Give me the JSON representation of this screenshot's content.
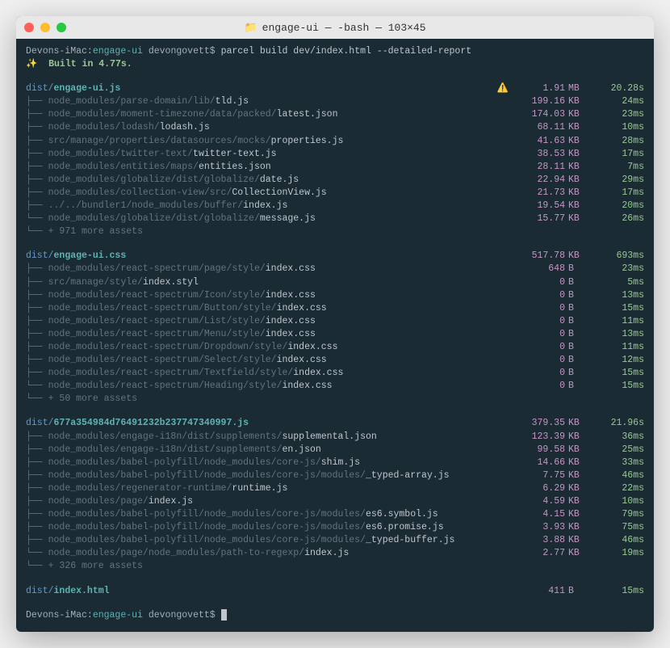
{
  "window": {
    "title_folder": "engage-ui",
    "title_sep": " — -bash — ",
    "title_dims": "103×45"
  },
  "prompt": {
    "host": "Devons-iMac:",
    "path": "engage-ui",
    "user": " devongovett$ ",
    "command": "parcel build dev/index.html --detailed-report"
  },
  "built": {
    "sparkle": "✨",
    "text": "  Built in 4.77s."
  },
  "bundles": [
    {
      "prefix": "dist/",
      "name": "engage-ui.js",
      "warn": "⚠️",
      "size": "1.91",
      "unit": "MB",
      "time": "20.28s",
      "assets": [
        {
          "dim": "node_modules/parse-domain/lib/",
          "file": "tld.js",
          "size": "199.16",
          "unit": "KB",
          "time": "24ms"
        },
        {
          "dim": "node_modules/moment-timezone/data/packed/",
          "file": "latest.json",
          "size": "174.03",
          "unit": "KB",
          "time": "23ms"
        },
        {
          "dim": "node_modules/lodash/",
          "file": "lodash.js",
          "size": "68.11",
          "unit": "KB",
          "time": "10ms"
        },
        {
          "dim": "src/manage/properties/datasources/mocks/",
          "file": "properties.js",
          "size": "41.63",
          "unit": "KB",
          "time": "28ms"
        },
        {
          "dim": "node_modules/twitter-text/",
          "file": "twitter-text.js",
          "size": "38.53",
          "unit": "KB",
          "time": "17ms"
        },
        {
          "dim": "node_modules/entities/maps/",
          "file": "entities.json",
          "size": "28.11",
          "unit": "KB",
          "time": "7ms"
        },
        {
          "dim": "node_modules/globalize/dist/globalize/",
          "file": "date.js",
          "size": "22.94",
          "unit": "KB",
          "time": "29ms"
        },
        {
          "dim": "node_modules/collection-view/src/",
          "file": "CollectionView.js",
          "size": "21.73",
          "unit": "KB",
          "time": "17ms"
        },
        {
          "dim": "../../bundler1/node_modules/buffer/",
          "file": "index.js",
          "size": "19.54",
          "unit": "KB",
          "time": "20ms"
        },
        {
          "dim": "node_modules/globalize/dist/globalize/",
          "file": "message.js",
          "size": "15.77",
          "unit": "KB",
          "time": "26ms"
        }
      ],
      "more": "+ 971 more assets"
    },
    {
      "prefix": "dist/",
      "name": "engage-ui.css",
      "warn": "",
      "size": "517.78",
      "unit": "KB",
      "time": "693ms",
      "assets": [
        {
          "dim": "node_modules/react-spectrum/page/style/",
          "file": "index.css",
          "size": "648",
          "unit": "B",
          "time": "23ms"
        },
        {
          "dim": "src/manage/style/",
          "file": "index.styl",
          "size": "0",
          "unit": "B",
          "time": "5ms"
        },
        {
          "dim": "node_modules/react-spectrum/Icon/style/",
          "file": "index.css",
          "size": "0",
          "unit": "B",
          "time": "13ms"
        },
        {
          "dim": "node_modules/react-spectrum/Button/style/",
          "file": "index.css",
          "size": "0",
          "unit": "B",
          "time": "15ms"
        },
        {
          "dim": "node_modules/react-spectrum/List/style/",
          "file": "index.css",
          "size": "0",
          "unit": "B",
          "time": "11ms"
        },
        {
          "dim": "node_modules/react-spectrum/Menu/style/",
          "file": "index.css",
          "size": "0",
          "unit": "B",
          "time": "13ms"
        },
        {
          "dim": "node_modules/react-spectrum/Dropdown/style/",
          "file": "index.css",
          "size": "0",
          "unit": "B",
          "time": "11ms"
        },
        {
          "dim": "node_modules/react-spectrum/Select/style/",
          "file": "index.css",
          "size": "0",
          "unit": "B",
          "time": "12ms"
        },
        {
          "dim": "node_modules/react-spectrum/Textfield/style/",
          "file": "index.css",
          "size": "0",
          "unit": "B",
          "time": "15ms"
        },
        {
          "dim": "node_modules/react-spectrum/Heading/style/",
          "file": "index.css",
          "size": "0",
          "unit": "B",
          "time": "15ms"
        }
      ],
      "more": "+ 50 more assets"
    },
    {
      "prefix": "dist/",
      "name": "677a354984d76491232b237747340997.js",
      "warn": "",
      "size": "379.35",
      "unit": "KB",
      "time": "21.96s",
      "assets": [
        {
          "dim": "node_modules/engage-i18n/dist/supplements/",
          "file": "supplemental.json",
          "size": "123.39",
          "unit": "KB",
          "time": "36ms"
        },
        {
          "dim": "node_modules/engage-i18n/dist/supplements/",
          "file": "en.json",
          "size": "99.58",
          "unit": "KB",
          "time": "25ms"
        },
        {
          "dim": "node_modules/babel-polyfill/node_modules/core-js/",
          "file": "shim.js",
          "size": "14.66",
          "unit": "KB",
          "time": "33ms"
        },
        {
          "dim": "node_modules/babel-polyfill/node_modules/core-js/modules/",
          "file": "_typed-array.js",
          "size": "7.75",
          "unit": "KB",
          "time": "46ms"
        },
        {
          "dim": "node_modules/regenerator-runtime/",
          "file": "runtime.js",
          "size": "6.29",
          "unit": "KB",
          "time": "22ms"
        },
        {
          "dim": "node_modules/page/",
          "file": "index.js",
          "size": "4.59",
          "unit": "KB",
          "time": "10ms"
        },
        {
          "dim": "node_modules/babel-polyfill/node_modules/core-js/modules/",
          "file": "es6.symbol.js",
          "size": "4.15",
          "unit": "KB",
          "time": "79ms"
        },
        {
          "dim": "node_modules/babel-polyfill/node_modules/core-js/modules/",
          "file": "es6.promise.js",
          "size": "3.93",
          "unit": "KB",
          "time": "75ms"
        },
        {
          "dim": "node_modules/babel-polyfill/node_modules/core-js/modules/",
          "file": "_typed-buffer.js",
          "size": "3.88",
          "unit": "KB",
          "time": "46ms"
        },
        {
          "dim": "node_modules/page/node_modules/path-to-regexp/",
          "file": "index.js",
          "size": "2.77",
          "unit": "KB",
          "time": "19ms"
        }
      ],
      "more": "+ 326 more assets"
    },
    {
      "prefix": "dist/",
      "name": "index.html",
      "warn": "",
      "size": "411",
      "unit": "B",
      "time": "15ms",
      "assets": [],
      "more": ""
    }
  ],
  "final_prompt": {
    "host": "Devons-iMac:",
    "path": "engage-ui",
    "user": " devongovett$ "
  }
}
